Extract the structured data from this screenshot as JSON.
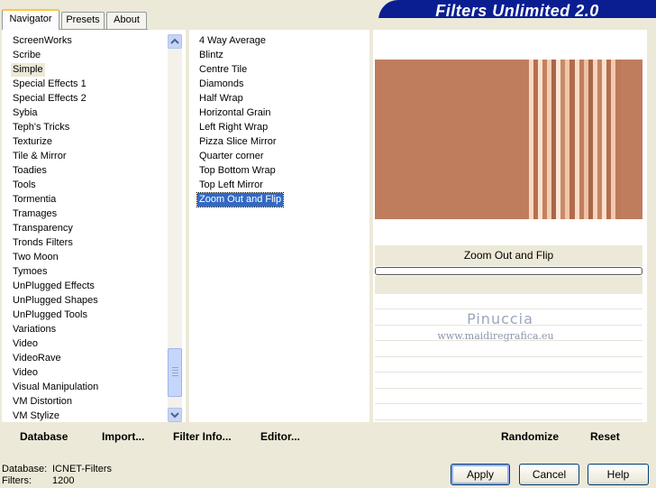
{
  "tabs": [
    "Navigator",
    "Presets",
    "About"
  ],
  "app_title": "Filters Unlimited 2.0",
  "categories": {
    "items": [
      "ScreenWorks",
      "Scribe",
      "Simple",
      "Special Effects 1",
      "Special Effects 2",
      "Sybia",
      "Teph's Tricks",
      "Texturize",
      "Tile & Mirror",
      "Toadies",
      "Tools",
      "Tormentia",
      "Tramages",
      "Transparency",
      "Tronds Filters",
      "Two Moon",
      "Tymoes",
      "UnPlugged Effects",
      "UnPlugged Shapes",
      "UnPlugged Tools",
      "Variations",
      "Video",
      "VideoRave",
      "Video",
      "Visual Manipulation",
      "VM Distortion",
      "VM Stylize"
    ],
    "selected": "Simple"
  },
  "filters": {
    "items": [
      "4 Way Average",
      "Blintz",
      "Centre Tile",
      "Diamonds",
      "Half Wrap",
      "Horizontal Grain",
      "Left Right Wrap",
      "Pizza Slice Mirror",
      "Quarter corner",
      "Top Bottom Wrap",
      "Top Left Mirror",
      "Zoom Out and Flip"
    ],
    "selected": "Zoom Out and Flip"
  },
  "left_buttons": {
    "database": "Database",
    "import": "Import...",
    "filter_info": "Filter Info...",
    "editor": "Editor..."
  },
  "right_buttons": {
    "randomize": "Randomize",
    "reset": "Reset"
  },
  "preview": {
    "filter_name": "Zoom Out and Flip",
    "base_color": "#bf7d5e",
    "progress": 0
  },
  "watermark": {
    "name": "Pinuccia",
    "url": "www.maidiregrafica.eu"
  },
  "footer": {
    "database_label": "Database:",
    "database_value": "ICNET-Filters",
    "filters_label": "Filters:",
    "filters_value": "1200"
  },
  "dialog_buttons": {
    "apply": "Apply",
    "cancel": "Cancel",
    "help": "Help"
  },
  "icons": {
    "scroll_up": "chevron-up-icon",
    "scroll_down": "chevron-down-icon"
  }
}
